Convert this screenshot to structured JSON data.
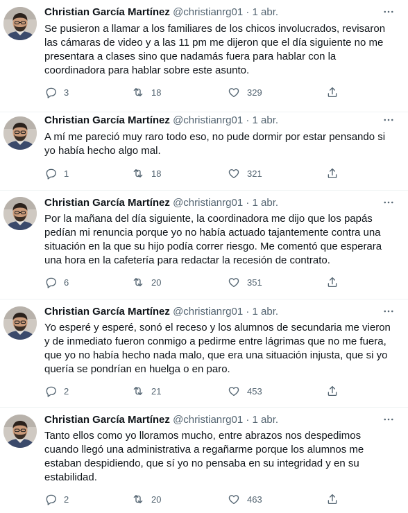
{
  "tweets": [
    {
      "name": "Christian García Martínez",
      "handle": "@christianrg01",
      "dot": "·",
      "time": "1 abr.",
      "text": "Se pusieron a llamar a los familiares de los chicos involucrados, revisaron las cámaras de video y a las 11 pm me dijeron que el día siguiente no me presentara a clases sino que nadamás fuera para hablar con la coordinadora para hablar sobre este asunto.",
      "replies": "3",
      "retweets": "18",
      "likes": "329"
    },
    {
      "name": "Christian García Martínez",
      "handle": "@christianrg01",
      "dot": "·",
      "time": "1 abr.",
      "text": "A mí me pareció muy raro todo eso, no pude dormir por estar pensando si yo había hecho algo mal.",
      "replies": "1",
      "retweets": "18",
      "likes": "321"
    },
    {
      "name": "Christian García Martínez",
      "handle": "@christianrg01",
      "dot": "·",
      "time": "1 abr.",
      "text": "Por la mañana del día siguiente, la coordinadora me dijo que los papás pedían mi renuncia porque yo no había actuado tajantemente contra una situación en la que su hijo podía correr riesgo. Me comentó que esperara una hora en la cafetería para redactar la recesión de contrato.",
      "replies": "6",
      "retweets": "20",
      "likes": "351"
    },
    {
      "name": "Christian García Martínez",
      "handle": "@christianrg01",
      "dot": "·",
      "time": "1 abr.",
      "text": "Yo esperé y esperé, sonó el receso y los alumnos de secundaria me vieron y de inmediato fueron conmigo a pedirme entre lágrimas que no me fuera, que yo no había hecho nada malo, que era una situación injusta, que si yo quería se pondrían en huelga o en paro.",
      "replies": "2",
      "retweets": "21",
      "likes": "453"
    },
    {
      "name": "Christian García Martínez",
      "handle": "@christianrg01",
      "dot": "·",
      "time": "1 abr.",
      "text": "Tanto ellos como yo lloramos mucho, entre abrazos nos despedimos cuando llegó una administrativa a regañarme porque los alumnos me estaban despidiendo, que sí yo no pensaba en su integridad y en su estabilidad.",
      "replies": "2",
      "retweets": "20",
      "likes": "463"
    }
  ],
  "icons": {
    "avatar": "profile-photo",
    "more": "more-dots-icon",
    "reply": "reply-icon",
    "retweet": "retweet-icon",
    "like": "heart-icon",
    "share": "share-icon"
  },
  "colors": {
    "text": "#0f1419",
    "secondary": "#536471",
    "divider": "#eff3f4"
  }
}
